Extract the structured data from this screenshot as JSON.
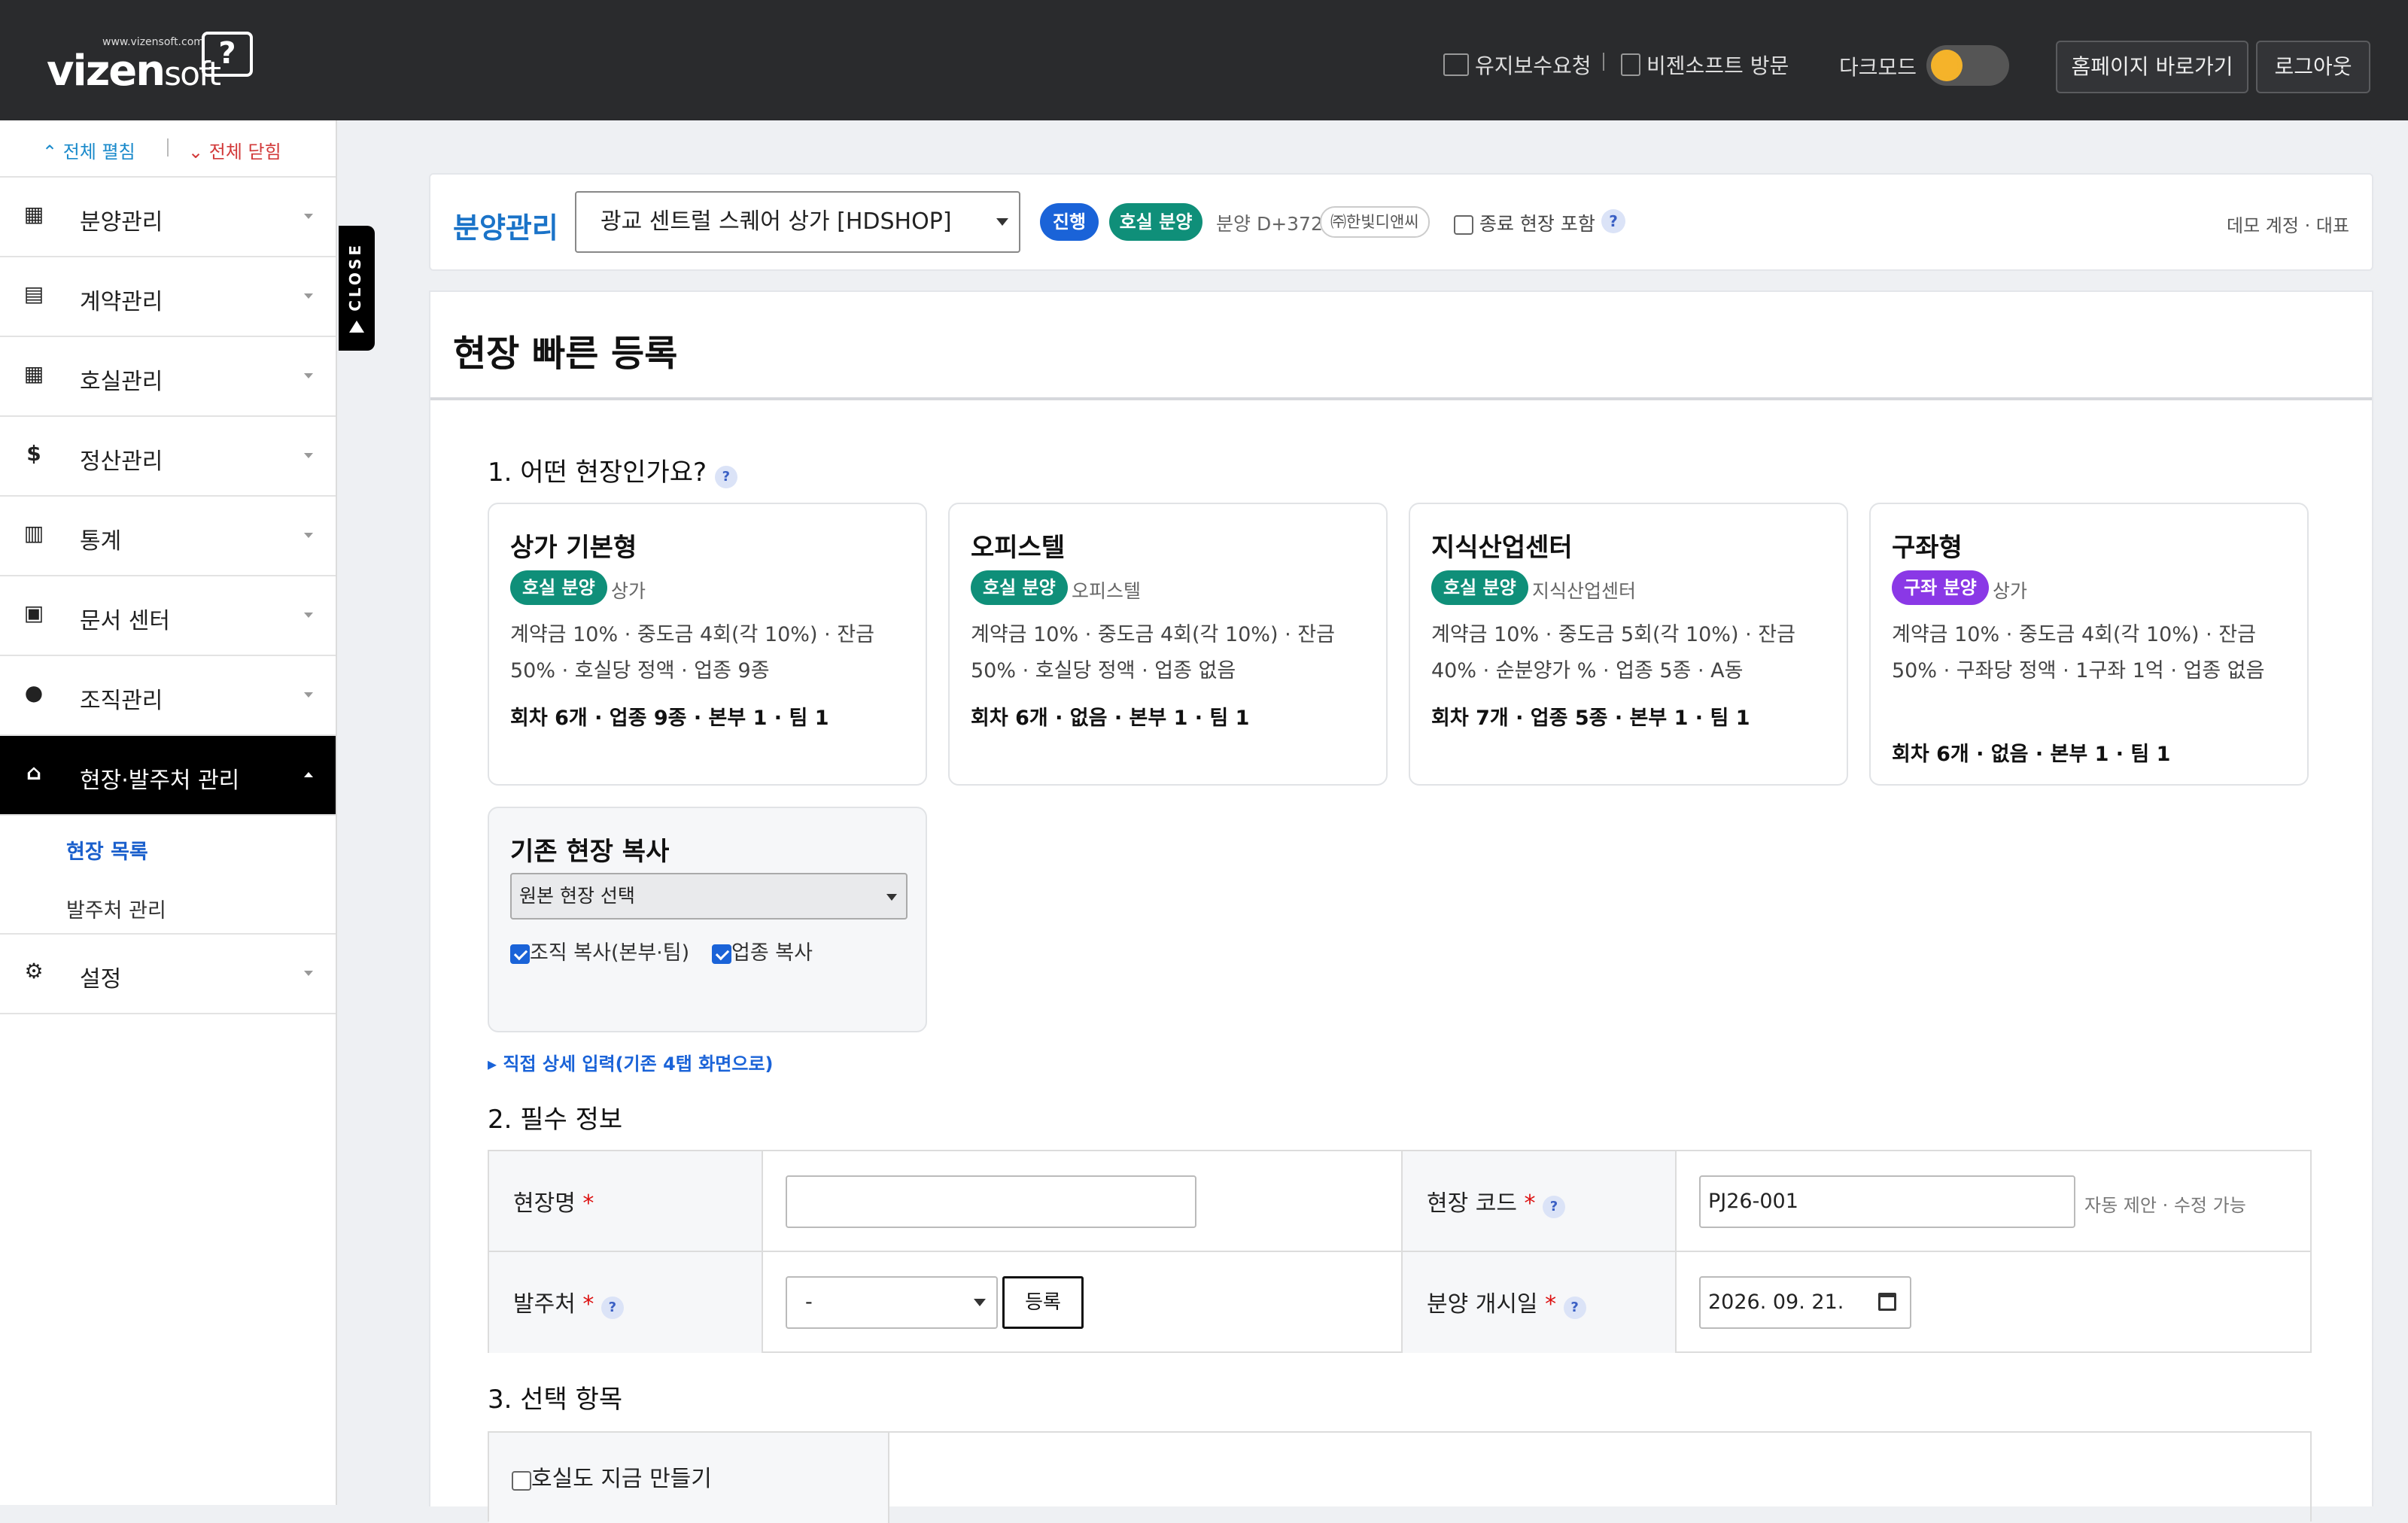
{
  "topbar": {
    "logo_url": "www.vizensoft.com",
    "logo_brand": "vizen",
    "logo_soft": "soft",
    "logo_q": "?",
    "maintenance": "유지보수요청",
    "visit": "비젠소프트 방문",
    "dark_mode": "다크모드",
    "homepage": "홈페이지 바로가기",
    "logout": "로그아웃"
  },
  "sidebar": {
    "expand_all": "⌃ 전체 펼침",
    "collapse_all": "⌄ 전체 닫힘",
    "items": [
      {
        "label": "분양관리",
        "icon": "building-icon"
      },
      {
        "label": "계약관리",
        "icon": "document-icon"
      },
      {
        "label": "호실관리",
        "icon": "grid-icon"
      },
      {
        "label": "정산관리",
        "icon": "dollar-icon"
      },
      {
        "label": "통계",
        "icon": "bar-chart-icon"
      },
      {
        "label": "문서 센터",
        "icon": "pdf-icon"
      },
      {
        "label": "조직관리",
        "icon": "people-icon"
      },
      {
        "label": "현장·발주처 관리",
        "icon": "bank-icon"
      },
      {
        "label": "설정",
        "icon": "gear-icon"
      }
    ],
    "submenu": [
      "현장 목록",
      "발주처 관리"
    ],
    "close_tab": "CLOSE"
  },
  "header": {
    "title": "분양관리",
    "site_selected": "광교 센트럴 스퀘어 상가 [HDSHOP]",
    "badge_progress": "진행",
    "badge_type": "호실 분양",
    "dday": "분양 D+372",
    "company": "㈜한빛디앤씨",
    "include_closed": "종료 현장 포함",
    "help": "?",
    "account": "데모 계정 · 대표",
    "colors": {
      "accent": "#1a73c8",
      "progress": "#1a63d8",
      "teal": "#0f8f79",
      "purple": "#8a38e6"
    }
  },
  "main": {
    "title": "현장 빠른 등록",
    "section1": "1. 어떤 현장인가요?",
    "templates": [
      {
        "name": "상가 기본형",
        "badge": "호실 분양",
        "type": "상가",
        "desc": "계약금 10% · 중도금 4회(각 10%) · 잔금 50% · 호실당 정액 · 업종 9종",
        "foot": "회차 6개 · 업종 9종 · 본부 1 · 팀 1"
      },
      {
        "name": "오피스텔",
        "badge": "호실 분양",
        "type": "오피스텔",
        "desc": "계약금 10% · 중도금 4회(각 10%) · 잔금 50% · 호실당 정액 · 업종 없음",
        "foot": "회차 6개 · 없음 · 본부 1 · 팀 1"
      },
      {
        "name": "지식산업센터",
        "badge": "호실 분양",
        "type": "지식산업센터",
        "desc": "계약금 10% · 중도금 5회(각 10%) · 잔금 40% · 순분양가 % · 업종 5종 · A동",
        "foot": "회차 7개 · 업종 5종 · 본부 1 · 팀 1"
      },
      {
        "name": "구좌형",
        "badge": "구좌 분양",
        "type": "상가",
        "desc": "계약금 10% · 중도금 4회(각 10%) · 잔금 50% · 구좌당 정액 · 1구좌 1억 · 업종 없음",
        "foot": "회차 6개 · 없음 · 본부 1 · 팀 1"
      }
    ],
    "copy": {
      "title": "기존 현장 복사",
      "select": "원본 현장 선택",
      "chk_org": "조직 복사(본부·팀)",
      "chk_biz": "업종 복사"
    },
    "detail_link": "▸ 직접 상세 입력(기존 4탭 화면으로)",
    "section2": "2. 필수 정보",
    "form": {
      "site_name": "현장명",
      "site_code": "현장 코드",
      "site_code_value": "PJ26-001",
      "site_code_hint": "자동 제안 · 수정 가능",
      "client": "발주처",
      "client_value": "-",
      "register": "등록",
      "open_date": "분양 개시일",
      "open_date_value": "2026. 09. 21.",
      "req": "*"
    },
    "section3": "3. 선택 항목",
    "opt_room": "호실도 지금 만들기"
  }
}
